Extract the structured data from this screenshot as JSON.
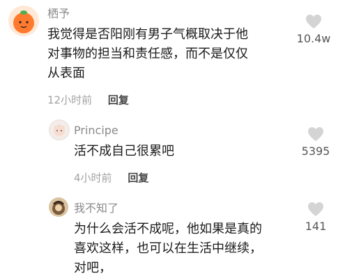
{
  "comments": [
    {
      "username": "栖予",
      "lines": [
        "我觉得是否阳刚有男子气概取决于他",
        "对事物的担当和责任感，而不是仅仅",
        "从表面"
      ],
      "time": "12小时前",
      "reply_label": "回复",
      "likes": "10.4w",
      "avatar_icon": "orange-fruit-avatar"
    },
    {
      "username": "Principe",
      "lines": [
        "活不成自己很累吧"
      ],
      "time": "4小时前",
      "reply_label": "回复",
      "likes": "5395",
      "avatar_icon": "boy-avatar"
    },
    {
      "username": "我不知了",
      "lines": [
        "为什么会活不成呢，他如果是真的",
        "喜欢这样，也可以在生活中继续，",
        "对吧，"
      ],
      "likes": "141",
      "avatar_icon": "cartoon-avatar"
    }
  ],
  "colors": {
    "text": "#1a1a1a",
    "meta": "#a3a3a3",
    "heart": "#d4d4d4"
  }
}
